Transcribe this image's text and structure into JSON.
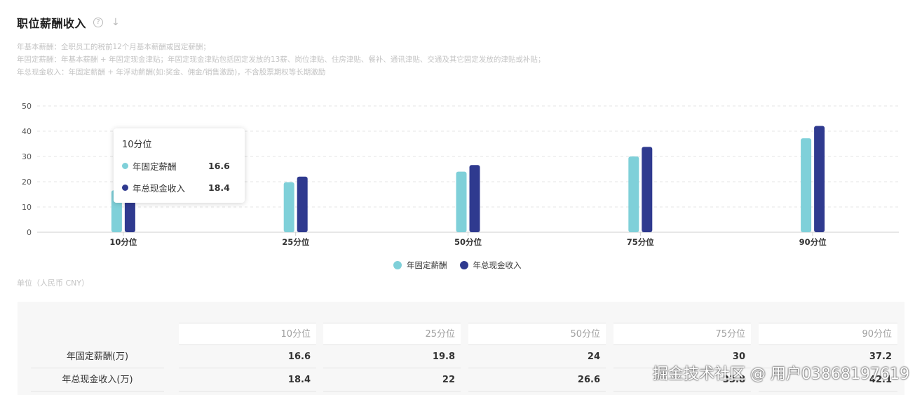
{
  "header": {
    "title": "职位薪酬收入",
    "help_icon": "?",
    "download_icon": "↓"
  },
  "notes": [
    "年基本薪酬：全职员工的税前12个月基本薪酬或固定薪酬；",
    "年固定薪酬：年基本薪酬 + 年固定现金津贴；年固定现金津贴包括固定发放的13薪、岗位津贴、住房津贴、餐补、通讯津贴、交通及其它固定发放的津贴或补贴；",
    "年总现金收入：年固定薪酬 + 年浮动薪酬(如:奖金、佣金/销售激励)，不含股票期权等长期激励"
  ],
  "unit_text": "单位（人民币 CNY）",
  "colors": {
    "fixed": "#7fd0d9",
    "cash": "#2f3a8f",
    "grid": "#e4e4e4",
    "axis": "#cfcfcf"
  },
  "chart_data": {
    "type": "bar",
    "categories": [
      "10分位",
      "25分位",
      "50分位",
      "75分位",
      "90分位"
    ],
    "series": [
      {
        "name": "年固定薪酬",
        "values": [
          16.6,
          19.8,
          24,
          30,
          37.2
        ]
      },
      {
        "name": "年总现金收入",
        "values": [
          18.4,
          22,
          26.6,
          33.8,
          42.1
        ]
      }
    ],
    "y_ticks": [
      "0",
      "10",
      "20",
      "30",
      "40",
      "50"
    ],
    "ylim": [
      0,
      50
    ],
    "grid": true,
    "legend": "bottom-center"
  },
  "tooltip": {
    "title": "10分位",
    "rows": [
      {
        "name": "年固定薪酬",
        "value": "16.6"
      },
      {
        "name": "年总现金收入",
        "value": "18.4"
      }
    ]
  },
  "table": {
    "columns": [
      "10分位",
      "25分位",
      "50分位",
      "75分位",
      "90分位"
    ],
    "rows": [
      {
        "label": "年固定薪酬(万)",
        "values": [
          "16.6",
          "19.8",
          "24",
          "30",
          "37.2"
        ]
      },
      {
        "label": "年总现金收入(万)",
        "values": [
          "18.4",
          "22",
          "26.6",
          "33.8",
          "42.1"
        ]
      }
    ]
  },
  "watermark": "掘金技术社区 @ 用户03868197619"
}
